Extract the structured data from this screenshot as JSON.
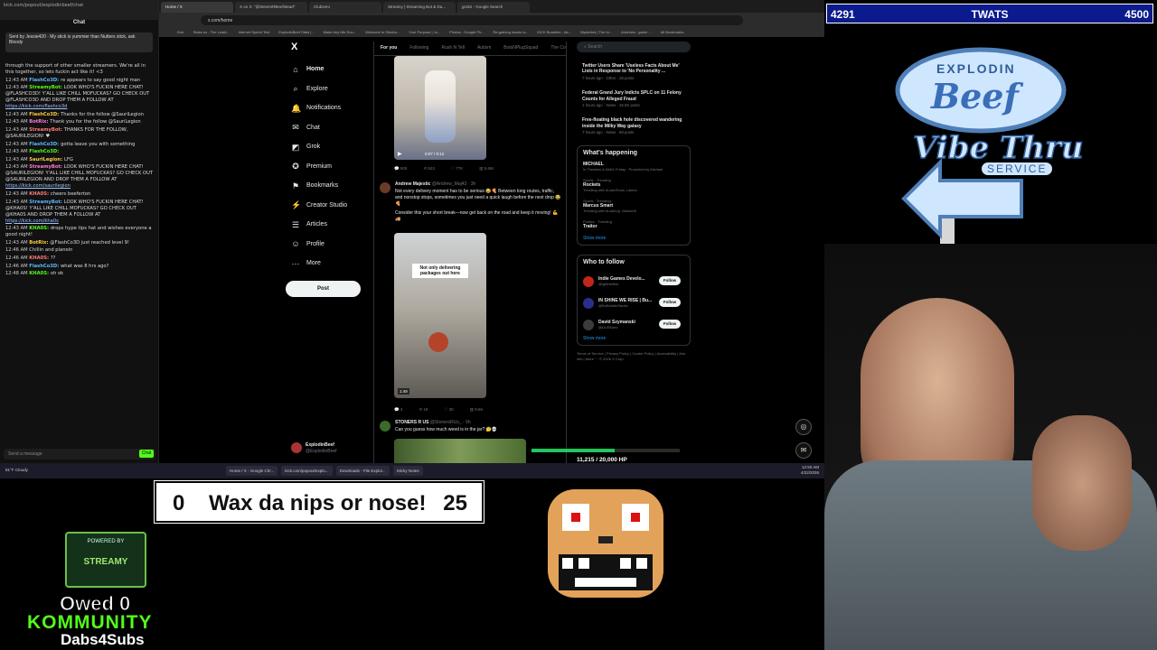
{
  "chat": {
    "title": "Chat",
    "pinned": "Sent by Jessie420 · My stick is yummier than Nutters stick, ask Bloody",
    "messages": [
      {
        "time": "",
        "user": "",
        "text": "through the support of other smaller streamers. We're all in this together, so lets fuckin act like it! <3"
      },
      {
        "time": "12:43 AM",
        "user": "FlashCo3D:",
        "text": "re appears to say good night man"
      },
      {
        "time": "12:43 AM",
        "user": "StreamyBot:",
        "text": "LOOK WHO'S FUCKIN HERE CHAT! @FLASHCO3D! Y'ALL LIKE CHILL MOFUCKAS? GO CHECK OUT @FLASHCO3D AND DROP THEM A FOLLOW AT",
        "link": "https://kick.com/flashco3d"
      },
      {
        "time": "12:43 AM",
        "user": "FlashCo3D:",
        "text": "Thanks for the follow @SauriLegion"
      },
      {
        "time": "12:43 AM",
        "user": "BotRix:",
        "text": "Thank you for the follow @SauriLegion"
      },
      {
        "time": "12:43 AM",
        "user": "StreamyBot:",
        "text": "THANKS FOR THE FOLLOW, @SAURILEGION! ♥"
      },
      {
        "time": "12:43 AM",
        "user": "FlashCo3D:",
        "text": "gotta leave you with something"
      },
      {
        "time": "12:43 AM",
        "user": "FlashCo3D:",
        "text": ""
      },
      {
        "time": "12:43 AM",
        "user": "SauriLegion:",
        "text": "LFG"
      },
      {
        "time": "12:43 AM",
        "user": "StreamyBot:",
        "text": "LOOK WHO'S FUCKIN HERE CHAT! @SAURILEGION! Y'ALL LIKE CHILL MOFUCKAS? GO CHECK OUT @SAURILEGION AND DROP THEM A FOLLOW AT",
        "link": "https://kick.com/saurilegion"
      },
      {
        "time": "12:43 AM",
        "user": "KHA0S:",
        "text": "cheers beeferton"
      },
      {
        "time": "12:43 AM",
        "user": "StreamyBot:",
        "text": "LOOK WHO'S FUCKIN HERE CHAT! @KHA0S! Y'ALL LIKE CHILL MOFUCKAS? GO CHECK OUT @KHA0S AND DROP THEM A FOLLOW AT",
        "link": "https://kick.com/kha0s"
      },
      {
        "time": "12:43 AM",
        "user": "KHA0S:",
        "text": "drops hype tips hat and wishes everyone a good night!"
      },
      {
        "time": "12:43 AM",
        "user": "BotRix:",
        "text": "@FlashCo3D just reached level 9!"
      },
      {
        "time": "12:46 AM",
        "user": "",
        "text": "Chillin and planoin"
      },
      {
        "time": "12:46 AM",
        "user": "KHA0S:",
        "text": "??"
      },
      {
        "time": "12:46 AM",
        "user": "FlashCo3D:",
        "text": "what was 8 hrs ago?"
      },
      {
        "time": "12:48 AM",
        "user": "KHA0S:",
        "text": "oh ok"
      }
    ],
    "input_placeholder": "Send a message",
    "send_label": "Chat"
  },
  "browser": {
    "tabs": [
      "Home / X",
      "X on X: \"@StevenRBeefstead\"",
      "Clubzero",
      "Streamy | Streaming Bot & Da...",
      "grok2 - Google Search"
    ],
    "url": "x.com/home",
    "bookmarks": [
      "Kick",
      "Stake.us - The Leadi...",
      "Internet Speed Test",
      "ExplodinBeef Stats |...",
      "Make Any Mic Sou...",
      "Welcome to Oklaho...",
      "Your Purpose | Jo...",
      "Photos - Google Ph...",
      "Re-gaining issues w...",
      "KICK Bounties - kic...",
      "Mysteries | The In...",
      "Andrews - game ...",
      "All Bookmarks"
    ]
  },
  "x": {
    "logo": "X",
    "nav": [
      {
        "icon": "⌂",
        "label": "Home"
      },
      {
        "icon": "⌕",
        "label": "Explore"
      },
      {
        "icon": "🔔",
        "label": "Notifications"
      },
      {
        "icon": "✉",
        "label": "Chat"
      },
      {
        "icon": "◩",
        "label": "Grok"
      },
      {
        "icon": "✪",
        "label": "Premium"
      },
      {
        "icon": "⚑",
        "label": "Bookmarks"
      },
      {
        "icon": "⚡",
        "label": "Creator Studio"
      },
      {
        "icon": "☰",
        "label": "Articles"
      },
      {
        "icon": "☺",
        "label": "Profile"
      },
      {
        "icon": "⋯",
        "label": "More"
      }
    ],
    "post_label": "Post",
    "profile_name": "ExplodinBeef",
    "profile_handle": "@ExplodinBeef",
    "feed_tabs": [
      "For you",
      "Following",
      "Rush N Tell",
      "Autism",
      "BotsNPlugSquad",
      "The Co"
    ],
    "tweet1_actions": [
      "505",
      "523",
      "77K",
      "5.6M"
    ],
    "tweet1_time": "0:07 / 0:12",
    "tweet2_name": "Andrew Majestic",
    "tweet2_handle": "@Andrew_Maj43 · 3h",
    "tweet2_body1": "Not every delivery moment has to be serious 😂🍕 Between long routes, traffic, and nonstop stops, sometimes you just need a quick laugh before the next drop 😂🍕",
    "tweet2_body2": "Consider this your short break—now get back on the road and keep it moving! 💪🚚",
    "tweet2_overlay": "Not only delivering packages out here",
    "tweet2_time": "1:49",
    "tweet2_actions": [
      "3",
      "18",
      "30",
      "9.6K"
    ],
    "tweet3_name": "STONERS R US",
    "tweet3_handle": "@StonersRUs_ · 5h",
    "tweet3_body": "Can you guess how much weed is in the jar? 🤔💀",
    "search_placeholder": "Search",
    "news": [
      {
        "title": "Twitter Users Share 'Useless Facts About Me' Lists in Response to 'No Personality ...",
        "meta": "7 hours ago · Other · 26 posts"
      },
      {
        "title": "Federal Grand Jury Indicts SPLC on 11 Felony Counts for Alleged Fraud",
        "meta": "1 hours ago · News · 32.9K posts"
      },
      {
        "title": "Free-floating black hole discovered wandering inside the Milky Way galaxy",
        "meta": "7 hours ago · News · 60 posts"
      }
    ],
    "whats_happening_title": "What's happening",
    "trends": [
      {
        "cat": "",
        "title": "MICHAEL",
        "sub": "In Theaters & IMAX Friday · Promoted by Michael"
      },
      {
        "cat": "Sports · Trending",
        "title": "Rockets",
        "sub": "Trending with #LakeShow, Lakers"
      },
      {
        "cat": "Sports · Trending",
        "title": "Marcus Smart",
        "sub": "Trending with #LakeUp, Mamorth"
      },
      {
        "cat": "Politics · Trending",
        "title": "Traitor",
        "sub": ""
      }
    ],
    "show_more": "Show more",
    "who_to_follow_title": "Who to follow",
    "who": [
      {
        "name": "Indie Games Develo...",
        "handle": "@igdthelibre"
      },
      {
        "name": "IN SHINE WE RISE | Bu...",
        "handle": "@BuBuilderStudio"
      },
      {
        "name": "David Szymanski",
        "handle": "@DUSKdev"
      }
    ],
    "follow_label": "Follow",
    "footer": "Terms of Service | Privacy Policy | Cookie Policy | Accessibility | Ads info | More ··· © 2026 X Corp."
  },
  "goal": {
    "text": "11,215 / 20,000 HP",
    "current": 11215,
    "target": 20000,
    "color": "#22c55e"
  },
  "taskbar": {
    "weather_temp": "81°F",
    "weather_desc": "Cloudy",
    "apps": [
      "Home / X - Google Chr...",
      "kick.com/popout/explo...",
      "Downloads - File Explor...",
      "Sticky Notes"
    ],
    "time": "12:50 AM",
    "date": "4/22/2026"
  },
  "overlay": {
    "score_left": "4291",
    "score_title": "TWATS",
    "score_right": "4500",
    "logo_top": "EXPLODIN",
    "logo_main": "Beef",
    "logo_sub": "Vibe Thru",
    "logo_service": "SERVICE",
    "wax_left": "0",
    "wax_text": "Wax da nips or nose!",
    "wax_right": "25",
    "streamy_top": "POWERED BY",
    "streamy_brand": "STREAMY",
    "owed": "Owed 0",
    "kommunity": "KOMMUNITY",
    "dabs": "Dabs4Subs",
    "accent": "#0b1a8c",
    "kick_green": "#53fc18"
  }
}
